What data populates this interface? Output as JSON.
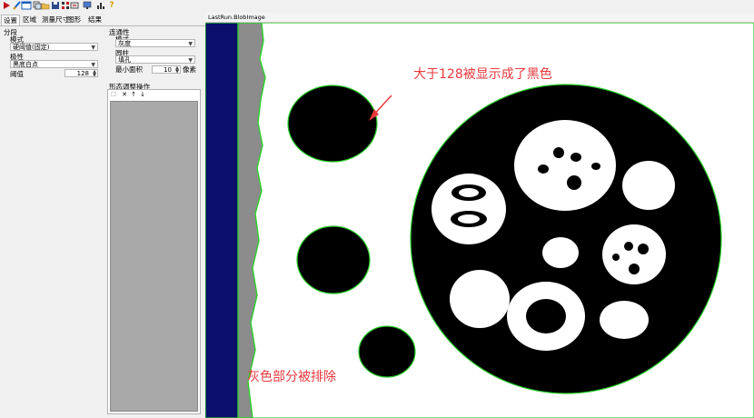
{
  "toolbar": {
    "buttons": [
      "run-icon",
      "pen-icon",
      "window-icon",
      "copy-icon",
      "open-folder-icon",
      "save-icon",
      "grid-icon",
      "swap-icon",
      "monitor-icon",
      "chart-icon",
      "help-icon"
    ],
    "help_glyph": "?"
  },
  "tabs": [
    {
      "label": "设置",
      "active": true
    },
    {
      "label": "区域",
      "active": false
    },
    {
      "label": "测量尺寸",
      "active": false
    },
    {
      "label": "图形",
      "active": false
    },
    {
      "label": "结果",
      "active": false
    }
  ],
  "segmentation": {
    "title": "分段",
    "mode_label": "模式",
    "mode_value": "硬阈值(固定)",
    "polarity_label": "极性",
    "polarity_value": "黑底白点",
    "threshold_label": "阈值",
    "threshold_value": "128"
  },
  "connectivity": {
    "title": "连通性",
    "mode_label": "模式",
    "mode_value": "灰度",
    "fill_label": "圆柱",
    "fill_value": "填孔",
    "min_area_label": "最小面积",
    "min_area_value": "10",
    "min_area_unit": "像素"
  },
  "morph_ops": {
    "title": "形态调整操作"
  },
  "image_window": {
    "title": "LastRun.BlobImage"
  },
  "annotations": {
    "top": "大于128被显示成了黑色",
    "bottom": "灰色部分被排除"
  },
  "colors": {
    "accent": "#e8383d",
    "edge": "#2bd12b",
    "navy": "#0b0f6b",
    "gray_strip": "#8c8c8c"
  }
}
